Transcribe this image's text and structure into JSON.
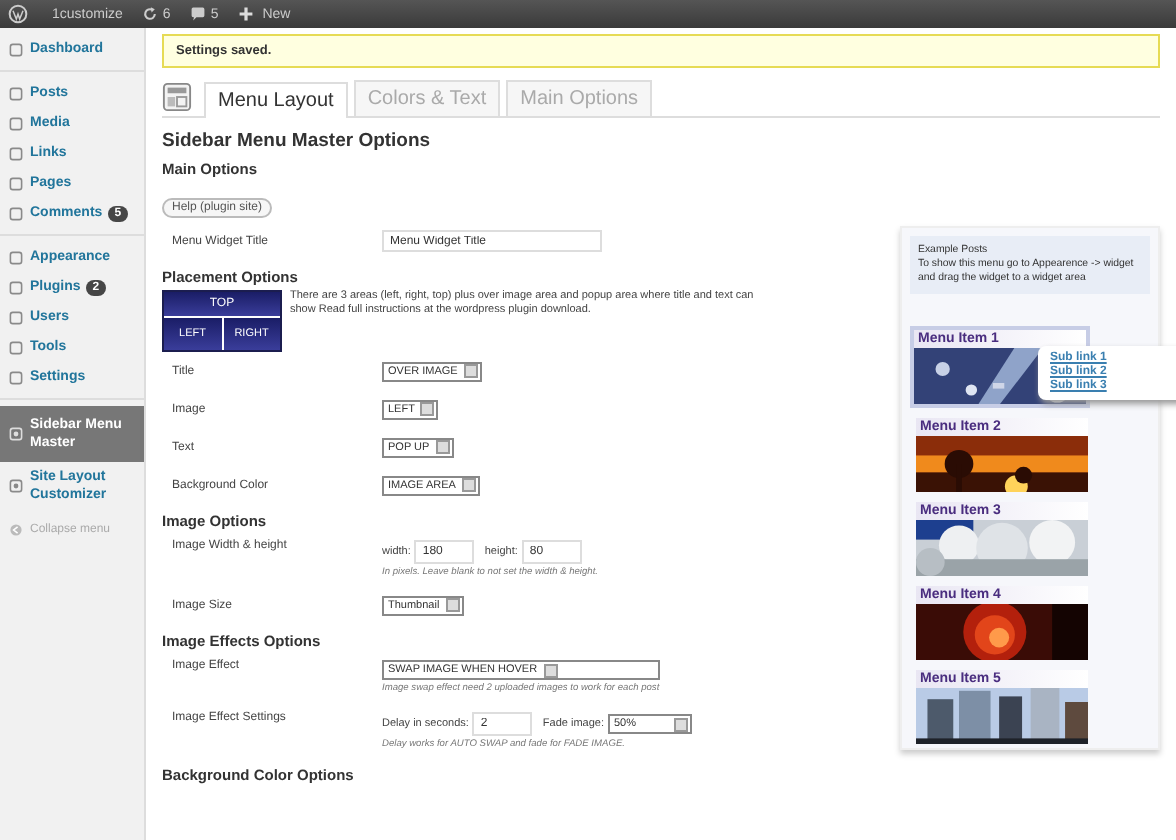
{
  "admin_bar": {
    "site": "1customize",
    "updates": "6",
    "comments": "5",
    "new": "New"
  },
  "sidebar": {
    "items": [
      {
        "label": "Dashboard",
        "current": false
      },
      {
        "label": "Posts",
        "current": false
      },
      {
        "label": "Media",
        "current": false
      },
      {
        "label": "Links",
        "current": false
      },
      {
        "label": "Pages",
        "current": false
      },
      {
        "label": "Comments",
        "badge": "5",
        "current": false
      },
      {
        "label": "Appearance",
        "current": false
      },
      {
        "label": "Plugins",
        "badge": "2",
        "current": false
      },
      {
        "label": "Users",
        "current": false
      },
      {
        "label": "Tools",
        "current": false
      },
      {
        "label": "Settings",
        "current": false
      },
      {
        "label": "Sidebar Menu Master",
        "current": true
      },
      {
        "label": "Site Layout Customizer",
        "current": false
      }
    ],
    "collapse": "Collapse menu"
  },
  "notice": "Settings saved.",
  "tabs": [
    {
      "label": "Menu Layout",
      "selected": true
    },
    {
      "label": "Colors & Text",
      "selected": false
    },
    {
      "label": "Main Options",
      "selected": false
    }
  ],
  "page_title": "Sidebar Menu Master Options",
  "main_options": {
    "heading": "Main Options",
    "help_button": "Help (plugin site)",
    "widget_title_label": "Menu Widget Title",
    "widget_title_value": "Menu Widget Title"
  },
  "placement": {
    "heading": "Placement Options",
    "diagram": {
      "top": "TOP",
      "left": "LEFT",
      "right": "RIGHT"
    },
    "description": "There are 3 areas (left, right, top) plus over image area and popup area where title and text can show Read full instructions at the wordpress plugin download.",
    "rows": [
      {
        "label": "Title",
        "value": "OVER IMAGE"
      },
      {
        "label": "Image",
        "value": "LEFT"
      },
      {
        "label": "Text",
        "value": "POP UP"
      },
      {
        "label": "Background Color",
        "value": "IMAGE AREA"
      }
    ]
  },
  "image_options": {
    "heading": "Image Options",
    "size_label": "Image Width & height",
    "width_label": "width:",
    "width_value": "180",
    "height_label": "height:",
    "height_value": "80",
    "size_hint": "In pixels. Leave blank to not set the width & height.",
    "image_size_label": "Image Size",
    "image_size_value": "Thumbnail"
  },
  "effects": {
    "heading": "Image Effects Options",
    "effect_label": "Image Effect",
    "effect_value": "SWAP IMAGE WHEN HOVER",
    "effect_hint": "Image swap effect need 2 uploaded images to work for each post",
    "settings_label": "Image Effect Settings",
    "delay_label": "Delay in seconds:",
    "delay_value": "2",
    "fade_label": "Fade image:",
    "fade_value": "50%",
    "settings_hint": "Delay works for AUTO SWAP and fade for FADE IMAGE."
  },
  "background_heading": "Background Color Options",
  "preview": {
    "note_title": "Example Posts",
    "note_text": "To show this menu go to Appearence -> widget and drag the widget to a widget area",
    "items": [
      {
        "title": "Menu Item 1",
        "selected": true
      },
      {
        "title": "Menu Item 2",
        "selected": false
      },
      {
        "title": "Menu Item 3",
        "selected": false
      },
      {
        "title": "Menu Item 4",
        "selected": false
      },
      {
        "title": "Menu Item 5",
        "selected": false
      }
    ],
    "sub_links": [
      "Sub link 1",
      "Sub link 2",
      "Sub link 3"
    ]
  }
}
